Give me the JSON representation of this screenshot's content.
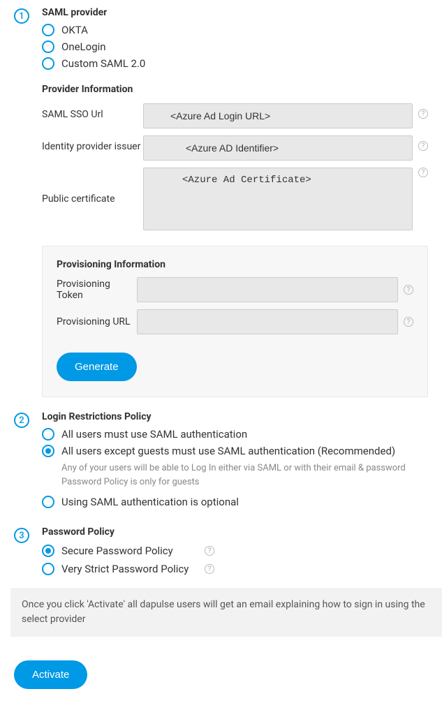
{
  "step1": {
    "number": "1",
    "title": "SAML provider",
    "options": {
      "okta": "OKTA",
      "onelogin": "OneLogin",
      "custom": "Custom SAML 2.0"
    },
    "provider_info_title": "Provider Information",
    "sso_url_label": "SAML SSO Url",
    "sso_url_value": "<Azure Ad Login URL>",
    "issuer_label": "Identity provider issuer",
    "issuer_value": "<Azure AD Identifier>",
    "cert_label": "Public certificate",
    "cert_value": "<Azure Ad Certificate>",
    "prov_title": "Provisioning Information",
    "prov_token_label": "Provisioning Token",
    "prov_token_value": "",
    "prov_url_label": "Provisioning URL",
    "prov_url_value": "",
    "generate_label": "Generate"
  },
  "step2": {
    "number": "2",
    "title": "Login Restrictions Policy",
    "opt_all": "All users must use SAML authentication",
    "opt_except": "All users except guests must use SAML authentication (Recommended)",
    "hint_line1": "Any of your users will be able to Log In either via SAML or with their email & password",
    "hint_line2": "Password Policy is only for guests",
    "opt_optional": "Using SAML authentication is optional"
  },
  "step3": {
    "number": "3",
    "title": "Password Policy",
    "opt_secure": "Secure Password Policy",
    "opt_strict": "Very Strict Password Policy"
  },
  "info_text": "Once you click 'Activate' all dapulse users will get an email explaining how to sign in using the select provider",
  "activate_label": "Activate"
}
